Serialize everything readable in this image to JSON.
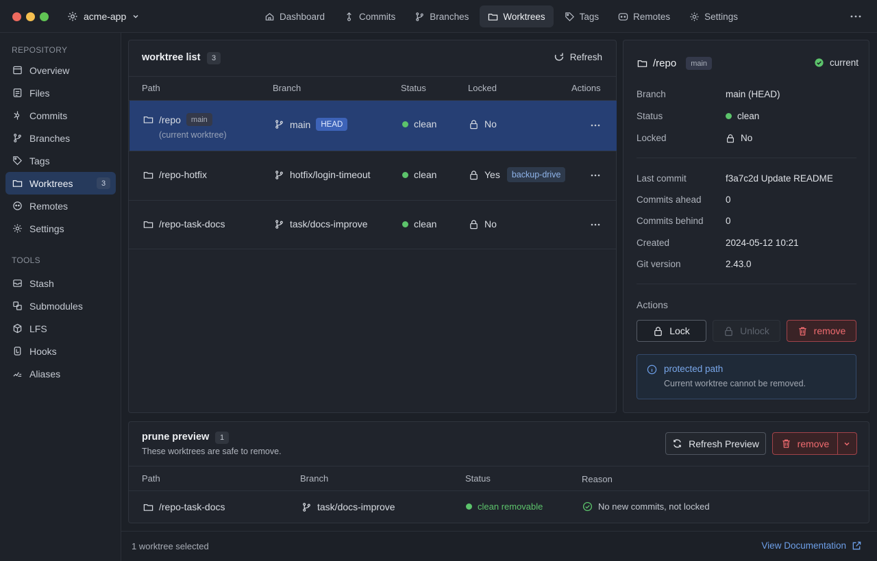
{
  "app": {
    "repo_name": "acme-app"
  },
  "nav": {
    "tabs": [
      {
        "label": "Dashboard",
        "icon": "home-icon"
      },
      {
        "label": "Commits",
        "icon": "commit-icon"
      },
      {
        "label": "Branches",
        "icon": "branch-icon"
      },
      {
        "label": "Worktrees",
        "icon": "folder-icon",
        "active": true
      },
      {
        "label": "Tags",
        "icon": "tag-icon"
      },
      {
        "label": "Remotes",
        "icon": "remote-icon"
      },
      {
        "label": "Settings",
        "icon": "gear-icon"
      }
    ]
  },
  "sidebar": {
    "repository_heading": "REPOSITORY",
    "tools_heading": "TOOLS",
    "items": [
      {
        "label": "Overview"
      },
      {
        "label": "Files"
      },
      {
        "label": "Commits"
      },
      {
        "label": "Branches"
      },
      {
        "label": "Tags"
      },
      {
        "label": "Worktrees",
        "badge": "3",
        "active": true
      },
      {
        "label": "Remotes"
      },
      {
        "label": "Settings"
      }
    ],
    "tools": [
      {
        "label": "Stash"
      },
      {
        "label": "Submodules"
      },
      {
        "label": "LFS"
      },
      {
        "label": "Hooks"
      },
      {
        "label": "Aliases"
      }
    ]
  },
  "worktree_list": {
    "title": "worktree list",
    "count": "3",
    "refresh_label": "Refresh",
    "columns": {
      "path": "Path",
      "branch": "Branch",
      "status": "Status",
      "locked": "Locked",
      "actions": "Actions"
    },
    "rows": [
      {
        "path": "/repo",
        "path_tag": "main",
        "subtitle": "(current worktree)",
        "branch": "main",
        "branch_tag": "HEAD",
        "status": "clean",
        "locked": "No",
        "lock_tag": ""
      },
      {
        "path": "/repo-hotfix",
        "path_tag": "",
        "subtitle": "",
        "branch": "hotfix/login-timeout",
        "branch_tag": "",
        "status": "clean",
        "locked": "Yes",
        "lock_tag": "backup-drive"
      },
      {
        "path": "/repo-task-docs",
        "path_tag": "",
        "subtitle": "",
        "branch": "task/docs-improve",
        "branch_tag": "",
        "status": "clean",
        "locked": "No",
        "lock_tag": ""
      }
    ]
  },
  "details": {
    "path": "/repo",
    "branch_tag": "main",
    "current_label": "current",
    "fields": {
      "branch_label": "Branch",
      "branch_value": "main (HEAD)",
      "status_label": "Status",
      "status_value": "clean",
      "locked_label": "Locked",
      "locked_value": "No",
      "last_commit_label": "Last commit",
      "last_commit_value": "f3a7c2d Update README",
      "ahead_label": "Commits ahead",
      "ahead_value": "0",
      "behind_label": "Commits behind",
      "behind_value": "0",
      "created_label": "Created",
      "created_value": "2024-05-12 10:21",
      "git_label": "Git version",
      "git_value": "2.43.0"
    },
    "actions_heading": "Actions",
    "lock_label": "Lock",
    "unlock_label": "Unlock",
    "remove_label": "remove",
    "notice_title": "protected path",
    "notice_body": "Current worktree cannot be removed."
  },
  "prune": {
    "title": "prune preview",
    "count": "1",
    "subtitle": "These worktrees are safe to remove.",
    "refresh_preview_label": "Refresh Preview",
    "remove_label": "remove",
    "columns": {
      "path": "Path",
      "branch": "Branch",
      "status": "Status",
      "reason": "Reason"
    },
    "rows": [
      {
        "path": "/repo-task-docs",
        "branch": "task/docs-improve",
        "status": "clean removable",
        "reason": "No new commits, not locked"
      }
    ]
  },
  "footer": {
    "selection_text": "1 worktree selected",
    "doc_link": "View Documentation"
  },
  "colors": {
    "accent": "#263f74",
    "success": "#5cc36b",
    "danger": "#ef6b6f",
    "link": "#6d9fe8"
  }
}
